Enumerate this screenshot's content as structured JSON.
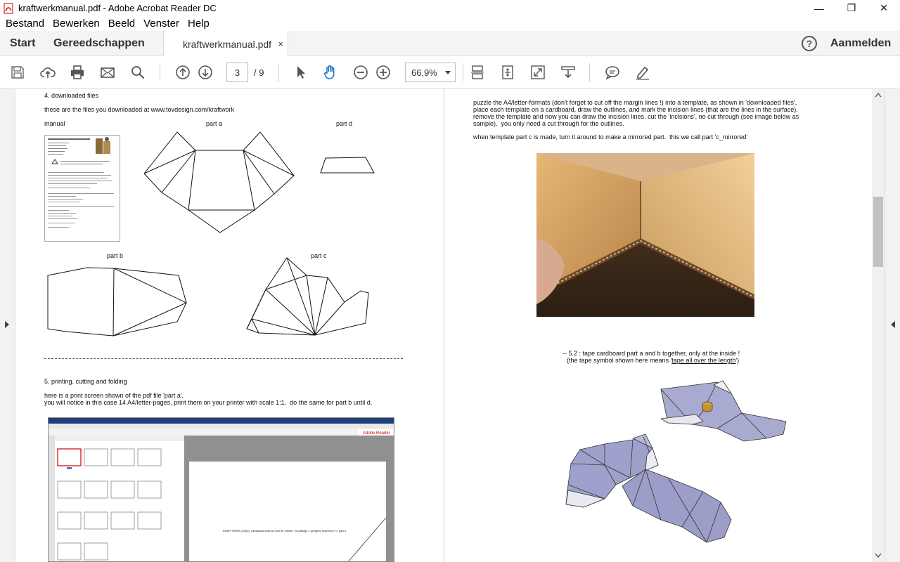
{
  "window": {
    "title": "kraftwerkmanual.pdf - Adobe Acrobat Reader DC",
    "controls": [
      "—",
      "❐",
      "✕"
    ]
  },
  "menu": [
    "Bestand",
    "Bewerken",
    "Beeld",
    "Venster",
    "Help"
  ],
  "tabs": {
    "start": "Start",
    "tools": "Gereedschappen",
    "document": "kraftwerkmanual.pdf",
    "close": "×",
    "help": "?",
    "signin": "Aanmelden"
  },
  "toolbar": {
    "page_current": "3",
    "page_total": "/ 9",
    "zoom": "66,9%"
  },
  "left_page": {
    "heading4": "4. downloaded files",
    "intro": "these are the files you downloaded at www.tovdesign.com/kraftwork",
    "label_manual": "manual",
    "label_part_a": "part a",
    "label_part_d": "part d",
    "label_part_b": "part b",
    "label_part_c": "part c",
    "heading5": "5. printing, cutting and folding",
    "para5_line1": "here is a print screen shown of the pdf file 'part a'.",
    "para5_line2": "you will notice in this case 14 A4/letter-pages, print them on your printer with scale 1:1.  do the same for part b until d.",
    "shot_footer": "KRAFTWERK (2000), cardboard chair by tom de vreese - tovdesign // all rights reserved © // part a"
  },
  "right_page": {
    "para_line1": "puzzle the A4/letter-formats (don't forget to cut off the margin lines !) into a template, as shown in 'downloaded files',",
    "para_line2": "place each template on a cardboard, draw the outlines, and mark the incision lines (that are the lines in the surface).",
    "para_line3": "remove the template and now you can draw the incision lines. cut the 'incisions', no cut through (see image below as",
    "para_line4": "sample).  you only need a cut through for the outlines.",
    "para_mirror": "when template part c is made, turn it around to make a mirrored part.  this we call part 'c_mirrored'",
    "step_line1": "-- 5.2 : tape cardboard part a and b together, only at the inside !",
    "step_line2_pre": "(the tape symbol shown here means '",
    "step_line2_link": "tape all over the length",
    "step_line2_post": "')"
  }
}
